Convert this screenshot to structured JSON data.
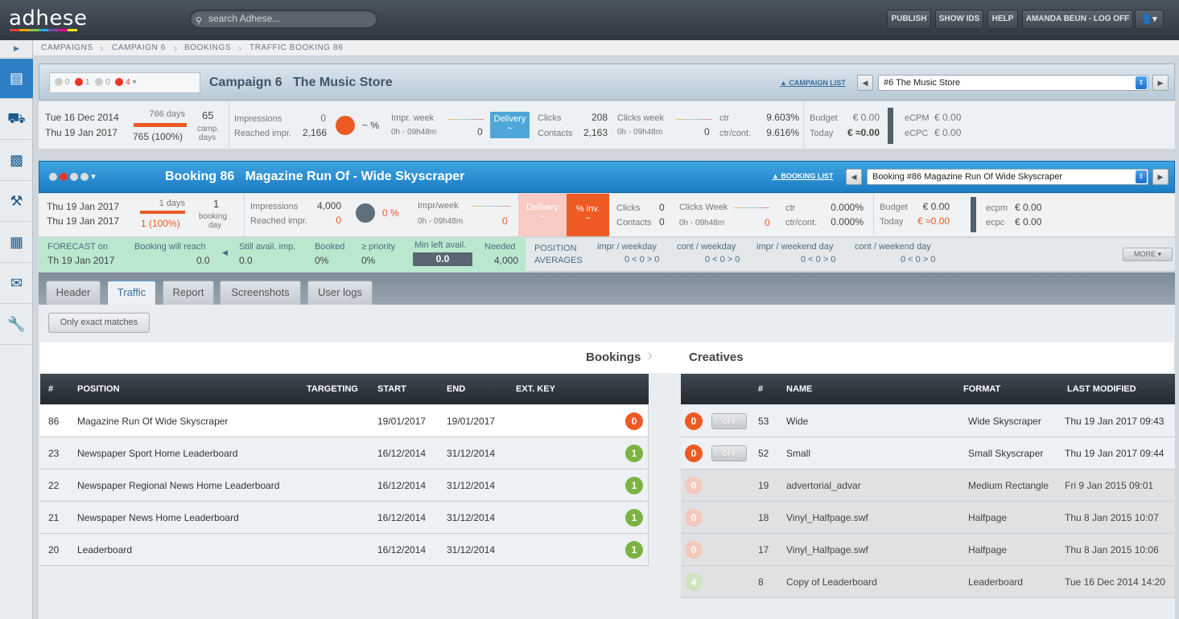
{
  "app": {
    "logo": "adhese",
    "logo_colors": [
      "#e8402b",
      "#f2a20e",
      "#8fc13f",
      "#27a9e1",
      "#7a4fa1",
      "#ec008c",
      "#f7ec13"
    ]
  },
  "search": {
    "placeholder": "search Adhese..."
  },
  "topnav": {
    "publish": "PUBLISH",
    "show_ids": "SHOW IDS",
    "help": "HELP",
    "user": "AMANDA BEUN - LOG OFF"
  },
  "breadcrumb": [
    "CAMPAIGNS",
    "CAMPAIGN 6",
    "BOOKINGS",
    "TRAFFIC BOOKING 86"
  ],
  "campaign": {
    "status_counts": [
      "0",
      "1",
      "0",
      "4"
    ],
    "title": "Campaign 6   The Music Store",
    "list_link": "CAMPAIGN LIST",
    "select_value": "#6 The Music Store",
    "start": "Tue 16 Dec 2014",
    "end": "Thu 19 Jan 2017",
    "days": "766 days",
    "days_pct": "765 (100%)",
    "camp_days_val": "65",
    "camp_days_lbl1": "camp.",
    "camp_days_lbl2": "days",
    "impressions_lbl": "Impressions",
    "impressions": "0",
    "reached_lbl": "Reached impr.",
    "reached": "2,166",
    "pct": "~ %",
    "impr_week_lbl": "Impr. week",
    "impr_week_time": "0h - 09h48m",
    "impr_week_val": "0",
    "delivery": "Delivery",
    "delivery_val": "~",
    "clicks_lbl": "Clicks",
    "clicks": "208",
    "contacts_lbl": "Contacts",
    "contacts": "2,163",
    "clicks_week_lbl": "Clicks week",
    "clicks_week_time": "0h - 09h48m",
    "clicks_week_val": "0",
    "ctr_lbl": "ctr",
    "ctr": "9.603%",
    "ctrc_lbl": "ctr/cont.",
    "ctrc": "9.616%",
    "budget_lbl": "Budget",
    "budget": "€ 0.00",
    "today_lbl": "Today",
    "today": "€ ≈0.00",
    "ecpm_lbl": "eCPM",
    "ecpm": "€ 0.00",
    "ecpc_lbl": "eCPC",
    "ecpc": "€ 0.00"
  },
  "booking": {
    "title": "Booking 86   Magazine Run Of - Wide Skyscraper",
    "list_link": "BOOKING LIST",
    "select_value": "Booking #86 Magazine Run Of Wide Skyscraper",
    "start": "Thu 19 Jan 2017",
    "end": "Thu 19 Jan 2017",
    "days": "1 days",
    "days_pct": "1 (100%)",
    "bday_val": "1",
    "bday_lbl1": "booking",
    "bday_lbl2": "day",
    "impressions_lbl": "Impressions",
    "impressions": "4,000",
    "reached_lbl": "Reached impr.",
    "reached": "0",
    "pct": "0 %",
    "impr_week_lbl": "Impr/week",
    "impr_week_time": "0h - 09h48m",
    "impr_week_val": "0",
    "delivery": "Delivery",
    "delivery_val": "~",
    "pinv": "% inv.",
    "pinv_val": "~",
    "clicks_lbl": "Clicks",
    "clicks": "0",
    "contacts_lbl": "Contacts",
    "contacts": "0",
    "clicks_week_lbl": "Clicks Week",
    "clicks_week_time": "0h - 09h48m",
    "clicks_week_val": "0",
    "ctr_lbl": "ctr",
    "ctr": "0.000%",
    "ctrc_lbl": "ctr/cont.",
    "ctrc": "0.000%",
    "budget_lbl": "Budget",
    "budget": "€ 0.00",
    "today_lbl": "Today",
    "today": "€ ≈0.00",
    "ecpm_lbl": "ecpm",
    "ecpm": "€ 0.00",
    "ecpc_lbl": "ecpc",
    "ecpc": "€ 0.00"
  },
  "forecast": {
    "on_lbl": "FORECAST on",
    "on_date": "Th 19 Jan 2017",
    "reach_lbl": "Booking will reach",
    "reach": "0.0",
    "still_lbl": "Still avail. imp.",
    "still": "0.0",
    "booked_lbl": "Booked",
    "booked": "0%",
    "prio_lbl": "≥ priority",
    "prio": "0%",
    "minleft_lbl": "Min left avail.",
    "minleft": "0.0",
    "needed_lbl": "Needed",
    "needed": "4,000",
    "pos_lbl1": "POSITION",
    "pos_lbl2": "AVERAGES",
    "impr_wd_lbl": "impr / weekday",
    "impr_wd": "0 < 0 > 0",
    "cont_wd_lbl": "cont / weekday",
    "cont_wd": "0 < 0 > 0",
    "impr_we_lbl": "impr / weekend day",
    "impr_we": "0 < 0 > 0",
    "cont_we_lbl": "cont / weekend day",
    "cont_we": "0 < 0 > 0",
    "more": "MORE"
  },
  "tabs": [
    "Header",
    "Traffic",
    "Report",
    "Screenshots",
    "User logs"
  ],
  "filter_button": "Only exact matches",
  "section": {
    "bookings": "Bookings",
    "creatives": "Creatives"
  },
  "bookings_table": {
    "headers": [
      "#",
      "POSITION",
      "TARGETING",
      "START",
      "END",
      "EXT. KEY"
    ],
    "rows": [
      {
        "id": "86",
        "position": "Magazine Run Of Wide Skyscraper",
        "start": "19/01/2017",
        "end": "19/01/2017",
        "count": "0",
        "color": "#ee5a24"
      },
      {
        "id": "23",
        "position": "Newspaper Sport Home Leaderboard",
        "start": "16/12/2014",
        "end": "31/12/2014",
        "count": "1",
        "color": "#7cb342"
      },
      {
        "id": "22",
        "position": "Newspaper Regional News Home Leaderboard",
        "start": "16/12/2014",
        "end": "31/12/2014",
        "count": "1",
        "color": "#7cb342"
      },
      {
        "id": "21",
        "position": "Newspaper News Home Leaderboard",
        "start": "16/12/2014",
        "end": "31/12/2014",
        "count": "1",
        "color": "#7cb342"
      },
      {
        "id": "20",
        "position": "Leaderboard",
        "start": "16/12/2014",
        "end": "31/12/2014",
        "count": "1",
        "color": "#7cb342"
      }
    ]
  },
  "creatives_table": {
    "headers": [
      "#",
      "NAME",
      "FORMAT",
      "LAST MODIFIED"
    ],
    "rows": [
      {
        "count": "0",
        "toggle": "OFF",
        "id": "53",
        "name": "Wide",
        "format": "Wide Skyscraper",
        "modified": "Thu 19 Jan 2017 09:43",
        "color": "#ee5a24",
        "active": true
      },
      {
        "count": "0",
        "toggle": "OFF",
        "id": "52",
        "name": "Small",
        "format": "Small Skyscraper",
        "modified": "Thu 19 Jan 2017 09:44",
        "color": "#ee5a24",
        "active": true
      },
      {
        "count": "0",
        "toggle": "",
        "id": "19",
        "name": "advertorial_advar",
        "format": "Medium Rectangle",
        "modified": "Fri 9 Jan 2015 09:01",
        "color": "#f3c9bd",
        "active": false
      },
      {
        "count": "0",
        "toggle": "",
        "id": "18",
        "name": "Vinyl_Halfpage.swf",
        "format": "Halfpage",
        "modified": "Thu 8 Jan 2015 10:07",
        "color": "#f3c9bd",
        "active": false
      },
      {
        "count": "0",
        "toggle": "",
        "id": "17",
        "name": "Vinyl_Halfpage.swf",
        "format": "Halfpage",
        "modified": "Thu 8 Jan 2015 10:06",
        "color": "#f3c9bd",
        "active": false
      },
      {
        "count": "4",
        "toggle": "",
        "id": "8",
        "name": "Copy of Leaderboard",
        "format": "Leaderboard",
        "modified": "Tue 16 Dec 2014 14:20",
        "color": "#cfe3c0",
        "active": false
      }
    ]
  }
}
